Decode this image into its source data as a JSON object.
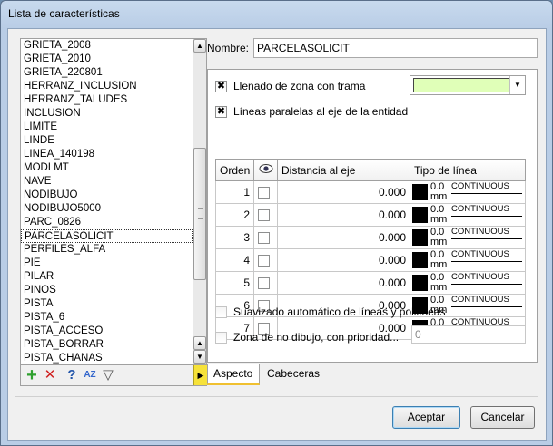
{
  "window": {
    "title": "Lista de características"
  },
  "list": {
    "items": [
      "GRIETA_2008",
      "GRIETA_2010",
      "GRIETA_220801",
      "HERRANZ_INCLUSION",
      "HERRANZ_TALUDES",
      "INCLUSION",
      "LIMITE",
      "LINDE",
      "LINEA_140198",
      "MODLMT",
      "NAVE",
      "NODIBUJO",
      "NODIBUJO5000",
      "PARC_0826",
      "PARCELASOLICIT",
      "PERFILES_ALFA",
      "PIE",
      "PILAR",
      "PINOS",
      "PISTA",
      "PISTA_6",
      "PISTA_ACCESO",
      "PISTA_BORRAR",
      "PISTA_CHANAS"
    ],
    "selected": "PARCELASOLICIT"
  },
  "form": {
    "name_label": "Nombre:",
    "name_value": "PARCELASOLICIT",
    "fill_label": "Llenado de zona con trama",
    "fill_checked": true,
    "fill_color": "#e0ffb8",
    "parallel_label": "Líneas paralelas al eje de la entidad",
    "parallel_checked": true,
    "columns": {
      "order": "Orden",
      "distance": "Distancia al eje",
      "linetype": "Tipo de línea"
    },
    "rows": [
      {
        "order": "1",
        "distance": "0.000",
        "width": "0.0",
        "unit": "mm",
        "type": "CONTINUOUS"
      },
      {
        "order": "2",
        "distance": "0.000",
        "width": "0.0",
        "unit": "mm",
        "type": "CONTINUOUS"
      },
      {
        "order": "3",
        "distance": "0.000",
        "width": "0.0",
        "unit": "mm",
        "type": "CONTINUOUS"
      },
      {
        "order": "4",
        "distance": "0.000",
        "width": "0.0",
        "unit": "mm",
        "type": "CONTINUOUS"
      },
      {
        "order": "5",
        "distance": "0.000",
        "width": "0.0",
        "unit": "mm",
        "type": "CONTINUOUS"
      },
      {
        "order": "6",
        "distance": "0.000",
        "width": "0.0",
        "unit": "mm",
        "type": "CONTINUOUS"
      },
      {
        "order": "7",
        "distance": "0.000",
        "width": "0.0",
        "unit": "mm",
        "type": "CONTINUOUS"
      }
    ],
    "smooth_label": "Suavizado automático de líneas y polilíneas",
    "nodraw_label": "Zona de no dibujo, con prioridad...",
    "nodraw_value": "0"
  },
  "tabs": [
    "Aspecto",
    "Cabeceras"
  ],
  "buttons": {
    "ok": "Aceptar",
    "cancel": "Cancelar"
  },
  "icons": [
    "add-icon",
    "delete-icon",
    "search-help-icon",
    "sort-az-icon",
    "filter-icon",
    "eye-icon"
  ]
}
